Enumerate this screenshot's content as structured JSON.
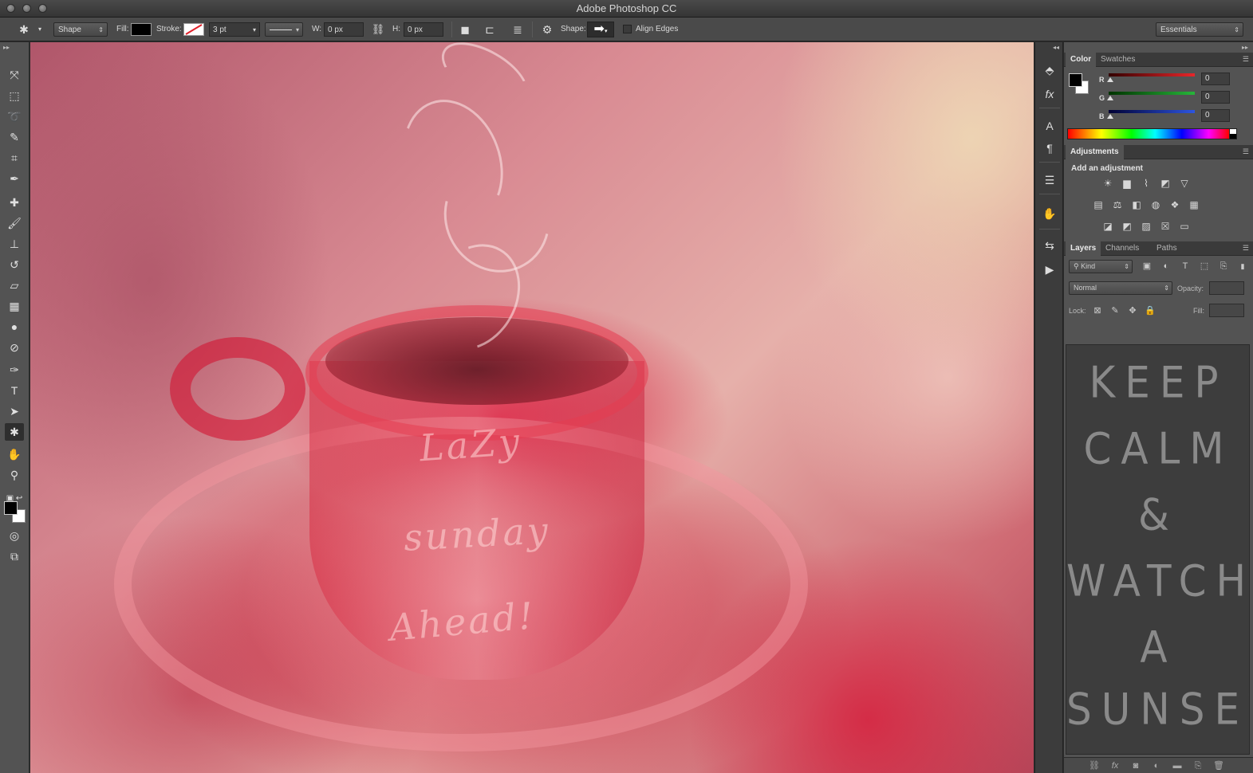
{
  "window": {
    "title": "Adobe Photoshop CC"
  },
  "options": {
    "tool_mode": "Shape",
    "fill_label": "Fill:",
    "stroke_label": "Stroke:",
    "stroke_width": "3 pt",
    "w_label": "W:",
    "w_value": "0 px",
    "h_label": "H:",
    "h_value": "0 px",
    "shape_label": "Shape:",
    "align_edges_label": "Align Edges",
    "workspace": "Essentials"
  },
  "tools": [
    {
      "name": "move",
      "glyph": "⤧"
    },
    {
      "name": "rect-marquee",
      "glyph": "⬚"
    },
    {
      "name": "lasso",
      "glyph": "➰"
    },
    {
      "name": "quick-select",
      "glyph": "✎"
    },
    {
      "name": "crop",
      "glyph": "⌗"
    },
    {
      "name": "eyedropper",
      "glyph": "✒"
    },
    {
      "name": "healing-brush",
      "glyph": "✚"
    },
    {
      "name": "brush",
      "glyph": "🖌"
    },
    {
      "name": "clone-stamp",
      "glyph": "⊥"
    },
    {
      "name": "history-brush",
      "glyph": "↺"
    },
    {
      "name": "eraser",
      "glyph": "▱"
    },
    {
      "name": "gradient",
      "glyph": "▦"
    },
    {
      "name": "blur",
      "glyph": "●"
    },
    {
      "name": "dodge",
      "glyph": "⊘"
    },
    {
      "name": "pen",
      "glyph": "✑"
    },
    {
      "name": "type",
      "glyph": "T"
    },
    {
      "name": "path-select",
      "glyph": "➤"
    },
    {
      "name": "custom-shape",
      "glyph": "✱",
      "active": true
    },
    {
      "name": "hand",
      "glyph": "✋"
    },
    {
      "name": "zoom",
      "glyph": "⚲"
    }
  ],
  "canvas_text": {
    "line1": "LaZy",
    "line2": "sunday",
    "line3": "Ahead!"
  },
  "color_panel": {
    "tabs": [
      "Color",
      "Swatches"
    ],
    "channels": [
      {
        "label": "R",
        "value": "0",
        "color": "#e8262a"
      },
      {
        "label": "G",
        "value": "0",
        "color": "#27b53a"
      },
      {
        "label": "B",
        "value": "0",
        "color": "#2d55e0"
      }
    ]
  },
  "adjustments_panel": {
    "tab": "Adjustments",
    "title": "Add an adjustment",
    "row1": [
      "brightness-icon",
      "levels-icon",
      "curves-icon",
      "exposure-icon",
      "vibrance-icon"
    ],
    "row2": [
      "hue-saturation-icon",
      "color-balance-icon",
      "black-white-icon",
      "photo-filter-icon",
      "channel-mixer-icon",
      "color-lookup-icon"
    ],
    "row3": [
      "invert-icon",
      "posterize-icon",
      "threshold-icon",
      "selective-color-icon",
      "gradient-map-icon"
    ]
  },
  "layers_panel": {
    "tabs": [
      "Layers",
      "Channels",
      "Paths"
    ],
    "filter_kind": "Kind",
    "blend_mode": "Normal",
    "opacity_label": "Opacity:",
    "lock_label": "Lock:",
    "fill_label": "Fill:",
    "poster_lines": [
      "KEEP",
      "CALM",
      "&",
      "WATCH",
      "A",
      "SUNSET"
    ]
  },
  "colors": {
    "chrome_dark": "#2b2b2b",
    "panel": "#535353",
    "accent_red": "#d7143c"
  }
}
